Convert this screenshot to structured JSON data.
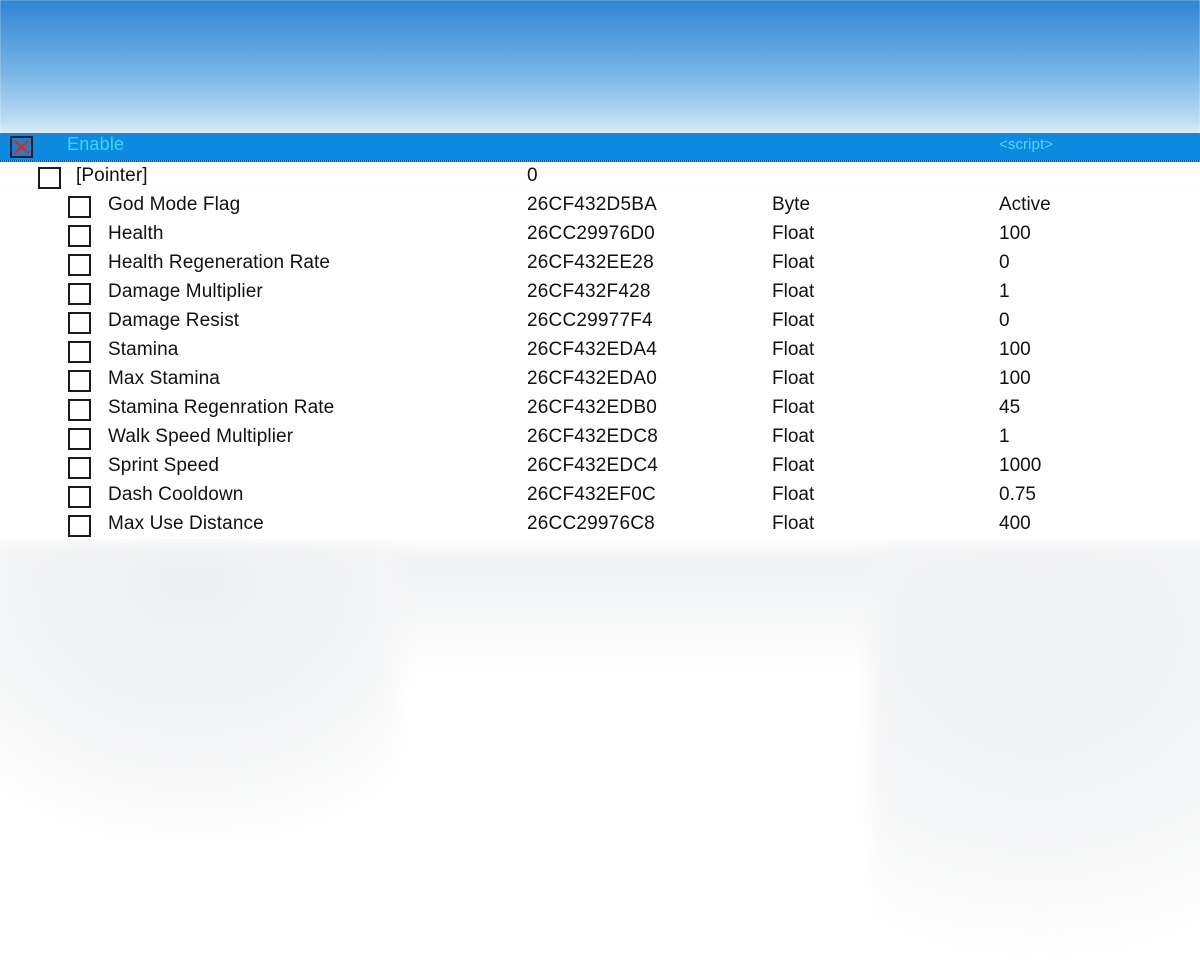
{
  "window": {
    "header": {
      "enable_checkbox_icon": "red-x-checkbox-icon",
      "enable_label": "Enable",
      "script_label": "<script>"
    }
  },
  "colors": {
    "header_background": "#0b8ae0",
    "header_enable_text": "#36d9f7",
    "header_script_text": "#4fdcf6",
    "row_text": "#111111",
    "panel_background": "#ffffff",
    "enable_checkbox_x": "#c0392b",
    "desktop_top": "#2f86d4",
    "desktop_bottom": "#f7f8f9"
  },
  "table": {
    "rows": [
      {
        "level": 0,
        "checked": false,
        "description": "[Pointer]",
        "address": "0",
        "type": "",
        "value": ""
      },
      {
        "level": 1,
        "checked": false,
        "description": "God Mode Flag",
        "address": "26CF432D5BA",
        "type": "Byte",
        "value": "Active"
      },
      {
        "level": 1,
        "checked": false,
        "description": "Health",
        "address": "26CC29976D0",
        "type": "Float",
        "value": "100"
      },
      {
        "level": 1,
        "checked": false,
        "description": "Health Regeneration Rate",
        "address": "26CF432EE28",
        "type": "Float",
        "value": "0"
      },
      {
        "level": 1,
        "checked": false,
        "description": "Damage Multiplier",
        "address": "26CF432F428",
        "type": "Float",
        "value": "1"
      },
      {
        "level": 1,
        "checked": false,
        "description": "Damage Resist",
        "address": "26CC29977F4",
        "type": "Float",
        "value": "0"
      },
      {
        "level": 1,
        "checked": false,
        "description": "Stamina",
        "address": "26CF432EDA4",
        "type": "Float",
        "value": "100"
      },
      {
        "level": 1,
        "checked": false,
        "description": "Max Stamina",
        "address": "26CF432EDA0",
        "type": "Float",
        "value": "100"
      },
      {
        "level": 1,
        "checked": false,
        "description": "Stamina Regenration Rate",
        "address": "26CF432EDB0",
        "type": "Float",
        "value": "45"
      },
      {
        "level": 1,
        "checked": false,
        "description": "Walk Speed Multiplier",
        "address": "26CF432EDC8",
        "type": "Float",
        "value": "1"
      },
      {
        "level": 1,
        "checked": false,
        "description": "Sprint Speed",
        "address": "26CF432EDC4",
        "type": "Float",
        "value": "1000"
      },
      {
        "level": 1,
        "checked": false,
        "description": "Dash Cooldown",
        "address": "26CF432EF0C",
        "type": "Float",
        "value": "0.75"
      },
      {
        "level": 1,
        "checked": false,
        "description": "Max Use Distance",
        "address": "26CC29976C8",
        "type": "Float",
        "value": "400"
      }
    ]
  }
}
